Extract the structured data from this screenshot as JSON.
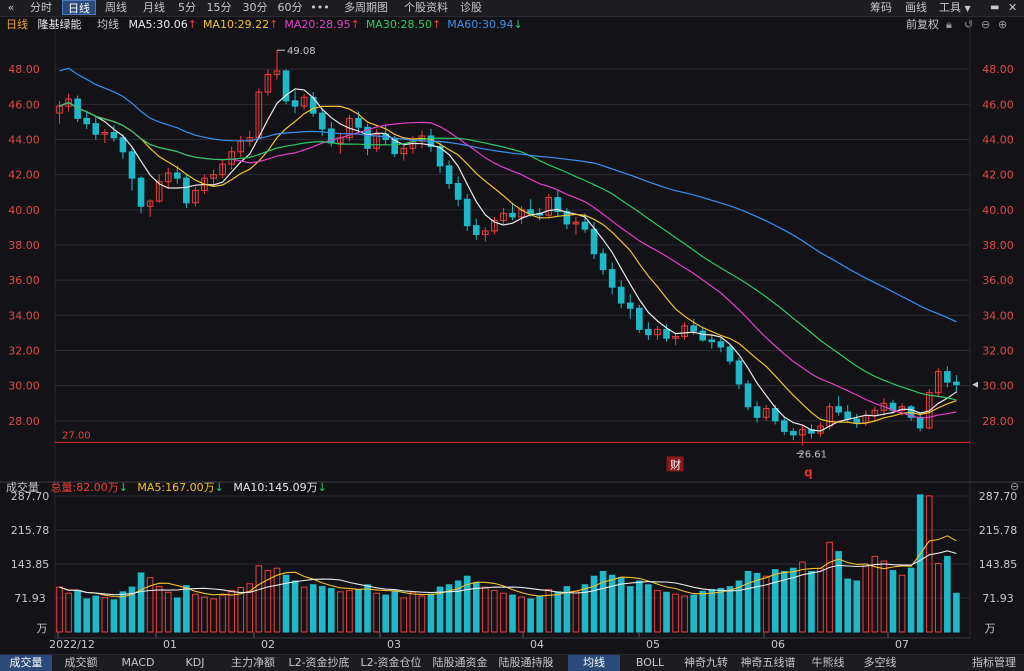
{
  "toolbar": {
    "collapse_icon": "double-chevron-left-icon",
    "items": [
      "分时",
      "日线",
      "周线",
      "月线",
      "5分",
      "15分",
      "30分",
      "60分",
      "•••",
      "多周期图",
      "个股资料",
      "诊股"
    ],
    "active_index": 1,
    "right_items": [
      "筹码",
      "画线",
      "工具"
    ]
  },
  "legend": {
    "period": "日线",
    "stock_name": "隆基绿能",
    "type": "均线",
    "ma": [
      {
        "label": "MA5:30.06",
        "color": "#e8e8e8",
        "arrow": "up"
      },
      {
        "label": "MA10:29.22",
        "color": "#f2c12e",
        "arrow": "up"
      },
      {
        "label": "MA20:28.95",
        "color": "#e040c8",
        "arrow": "up"
      },
      {
        "label": "MA30:28.50",
        "color": "#2ec866",
        "arrow": "up"
      },
      {
        "label": "MA60:30.94",
        "color": "#3b8ff0",
        "arrow": "down"
      }
    ],
    "adjust": "前复权",
    "icons": [
      "lock-icon",
      "undo-icon",
      "minus-icon",
      "plus-icon"
    ]
  },
  "price_axis": {
    "ticks": [
      "48.00",
      "46.00",
      "44.00",
      "42.00",
      "40.00",
      "38.00",
      "36.00",
      "34.00",
      "32.00",
      "30.00",
      "28.00"
    ],
    "max_label": "49.08",
    "min_label": "26.61",
    "support_label": "27.00",
    "event_badge": "财",
    "event_marker": "q"
  },
  "volume_legend": {
    "title": "成交量",
    "total": "总量:82.00万",
    "ma5": "MA5:167.00万",
    "ma10": "MA10:145.09万"
  },
  "volume_axis": {
    "ticks": [
      "287.70",
      "215.78",
      "143.85",
      "71.93"
    ],
    "unit": "万"
  },
  "date_axis": [
    "2022/12",
    "01",
    "02",
    "03",
    "04",
    "05",
    "06",
    "07"
  ],
  "bottom_tabs": [
    "成交量",
    "成交额",
    "MACD",
    "KDJ",
    "主力净额",
    "L2-资金抄底",
    "L2-资金仓位",
    "陆股通资金",
    "陆股通持股"
  ],
  "bottom_tabs_active": 0,
  "bottom_right_tabs": [
    "均线",
    "BOLL",
    "神奇九转",
    "神奇五线谱",
    "牛熊线",
    "多空线"
  ],
  "bottom_right_active": 0,
  "bottom_right_end": "指标管理",
  "colors": {
    "up": "#f03c3c",
    "down": "#1fb8c8",
    "background": "#131317",
    "grid": "#2a2a30"
  },
  "chart_data": {
    "type": "candlestick",
    "y_range": [
      26.0,
      50.0
    ],
    "volume_range": [
      0,
      287.7
    ],
    "candles": [
      [
        45.5,
        46.2,
        44.9,
        45.9
      ],
      [
        45.9,
        46.6,
        45.6,
        46.3
      ],
      [
        46.3,
        46.5,
        45.0,
        45.2
      ],
      [
        45.2,
        45.6,
        44.6,
        44.9
      ],
      [
        44.9,
        45.3,
        44.0,
        44.3
      ],
      [
        44.3,
        44.6,
        43.8,
        44.4
      ],
      [
        44.4,
        44.8,
        43.9,
        44.1
      ],
      [
        44.1,
        44.3,
        42.9,
        43.3
      ],
      [
        43.3,
        43.6,
        41.1,
        41.8
      ],
      [
        41.8,
        41.9,
        39.8,
        40.2
      ],
      [
        40.2,
        40.6,
        39.6,
        40.5
      ],
      [
        40.5,
        42.0,
        40.4,
        41.6
      ],
      [
        41.6,
        42.4,
        41.2,
        42.1
      ],
      [
        42.1,
        42.5,
        41.5,
        41.8
      ],
      [
        41.8,
        42.0,
        40.1,
        40.4
      ],
      [
        40.4,
        41.3,
        40.2,
        41.1
      ],
      [
        41.1,
        42.0,
        40.9,
        41.8
      ],
      [
        41.8,
        42.3,
        41.4,
        42.0
      ],
      [
        42.0,
        42.8,
        41.8,
        42.6
      ],
      [
        42.6,
        43.6,
        42.3,
        43.3
      ],
      [
        43.3,
        44.2,
        43.0,
        43.9
      ],
      [
        43.9,
        44.5,
        43.6,
        44.1
      ],
      [
        44.1,
        46.9,
        44.0,
        46.7
      ],
      [
        46.7,
        48.0,
        46.5,
        47.7
      ],
      [
        47.7,
        49.08,
        47.4,
        47.9
      ],
      [
        47.9,
        48.0,
        46.0,
        46.2
      ],
      [
        46.2,
        46.8,
        45.5,
        45.9
      ],
      [
        45.9,
        46.6,
        45.7,
        46.4
      ],
      [
        46.4,
        46.7,
        45.3,
        45.5
      ],
      [
        45.5,
        45.8,
        44.2,
        44.6
      ],
      [
        44.6,
        45.0,
        43.6,
        43.8
      ],
      [
        43.8,
        44.4,
        43.2,
        44.1
      ],
      [
        44.1,
        45.4,
        43.9,
        45.2
      ],
      [
        45.2,
        45.6,
        44.4,
        44.7
      ],
      [
        44.7,
        44.9,
        43.1,
        43.5
      ],
      [
        43.5,
        44.6,
        43.3,
        44.3
      ],
      [
        44.3,
        44.8,
        43.7,
        44.0
      ],
      [
        44.0,
        44.2,
        43.0,
        43.2
      ],
      [
        43.2,
        43.8,
        42.8,
        43.5
      ],
      [
        43.5,
        44.2,
        43.2,
        43.9
      ],
      [
        43.9,
        44.5,
        43.5,
        44.2
      ],
      [
        44.2,
        44.6,
        43.3,
        43.6
      ],
      [
        43.6,
        43.9,
        42.1,
        42.5
      ],
      [
        42.5,
        42.8,
        41.2,
        41.5
      ],
      [
        41.5,
        41.9,
        40.2,
        40.6
      ],
      [
        40.6,
        40.9,
        38.8,
        39.1
      ],
      [
        39.1,
        39.5,
        38.3,
        38.6
      ],
      [
        38.6,
        39.0,
        38.2,
        38.8
      ],
      [
        38.8,
        39.6,
        38.6,
        39.4
      ],
      [
        39.4,
        40.1,
        39.2,
        39.8
      ],
      [
        39.8,
        40.4,
        39.4,
        39.6
      ],
      [
        39.6,
        40.2,
        39.2,
        40.0
      ],
      [
        40.0,
        40.6,
        39.6,
        39.8
      ],
      [
        39.8,
        40.1,
        39.4,
        39.7
      ],
      [
        39.7,
        40.9,
        39.5,
        40.7
      ],
      [
        40.7,
        41.1,
        39.6,
        39.9
      ],
      [
        39.9,
        40.1,
        38.9,
        39.2
      ],
      [
        39.2,
        39.6,
        38.6,
        39.3
      ],
      [
        39.3,
        39.8,
        38.7,
        38.9
      ],
      [
        38.9,
        39.3,
        37.2,
        37.5
      ],
      [
        37.5,
        37.8,
        36.3,
        36.6
      ],
      [
        36.6,
        37.0,
        35.2,
        35.6
      ],
      [
        35.6,
        36.0,
        34.4,
        34.7
      ],
      [
        34.7,
        35.2,
        33.8,
        34.4
      ],
      [
        34.4,
        34.6,
        33.0,
        33.2
      ],
      [
        33.2,
        33.6,
        32.6,
        32.9
      ],
      [
        32.9,
        33.4,
        32.6,
        33.2
      ],
      [
        33.2,
        33.5,
        32.5,
        32.7
      ],
      [
        32.7,
        33.0,
        32.3,
        32.8
      ],
      [
        32.8,
        33.6,
        32.6,
        33.4
      ],
      [
        33.4,
        33.8,
        32.9,
        33.1
      ],
      [
        33.1,
        33.3,
        32.5,
        32.6
      ],
      [
        32.6,
        32.9,
        32.1,
        32.5
      ],
      [
        32.5,
        32.8,
        31.9,
        32.2
      ],
      [
        32.2,
        32.4,
        31.2,
        31.4
      ],
      [
        31.4,
        31.6,
        29.8,
        30.1
      ],
      [
        30.1,
        30.3,
        28.6,
        28.8
      ],
      [
        28.8,
        29.1,
        27.9,
        28.2
      ],
      [
        28.2,
        28.9,
        28.0,
        28.7
      ],
      [
        28.7,
        28.9,
        27.8,
        28.0
      ],
      [
        28.0,
        28.2,
        27.2,
        27.4
      ],
      [
        27.4,
        27.6,
        26.9,
        27.2
      ],
      [
        27.2,
        27.7,
        26.61,
        27.5
      ],
      [
        27.5,
        27.8,
        27.0,
        27.3
      ],
      [
        27.3,
        27.9,
        27.1,
        27.7
      ],
      [
        27.7,
        29.0,
        27.5,
        28.8
      ],
      [
        28.8,
        29.4,
        28.3,
        28.5
      ],
      [
        28.5,
        28.9,
        27.9,
        28.1
      ],
      [
        28.1,
        28.4,
        27.6,
        27.9
      ],
      [
        27.9,
        28.6,
        27.7,
        28.3
      ],
      [
        28.3,
        28.8,
        28.0,
        28.6
      ],
      [
        28.6,
        29.3,
        28.3,
        29.0
      ],
      [
        29.0,
        29.2,
        28.4,
        28.6
      ],
      [
        28.6,
        29.0,
        28.3,
        28.8
      ],
      [
        28.8,
        28.9,
        28.0,
        28.2
      ],
      [
        28.2,
        28.5,
        27.4,
        27.6
      ],
      [
        27.6,
        29.8,
        27.5,
        29.6
      ],
      [
        29.6,
        31.0,
        29.4,
        30.8
      ],
      [
        30.8,
        31.1,
        29.9,
        30.2
      ],
      [
        30.2,
        30.6,
        29.6,
        30.06
      ]
    ],
    "volumes": [
      95,
      82,
      88,
      70,
      76,
      73,
      68,
      85,
      95,
      125,
      115,
      96,
      84,
      72,
      98,
      80,
      74,
      70,
      78,
      88,
      94,
      102,
      140,
      130,
      135,
      120,
      108,
      95,
      100,
      96,
      92,
      85,
      88,
      90,
      100,
      82,
      78,
      86,
      72,
      84,
      76,
      80,
      95,
      100,
      108,
      118,
      105,
      95,
      88,
      82,
      78,
      74,
      70,
      76,
      90,
      85,
      96,
      86,
      100,
      118,
      128,
      120,
      115,
      96,
      108,
      100,
      88,
      84,
      80,
      76,
      78,
      86,
      90,
      92,
      96,
      108,
      128,
      124,
      118,
      132,
      128,
      135,
      148,
      128,
      135,
      190,
      170,
      112,
      108,
      140,
      160,
      150,
      130,
      120,
      135,
      290,
      288,
      145,
      160,
      82
    ]
  }
}
